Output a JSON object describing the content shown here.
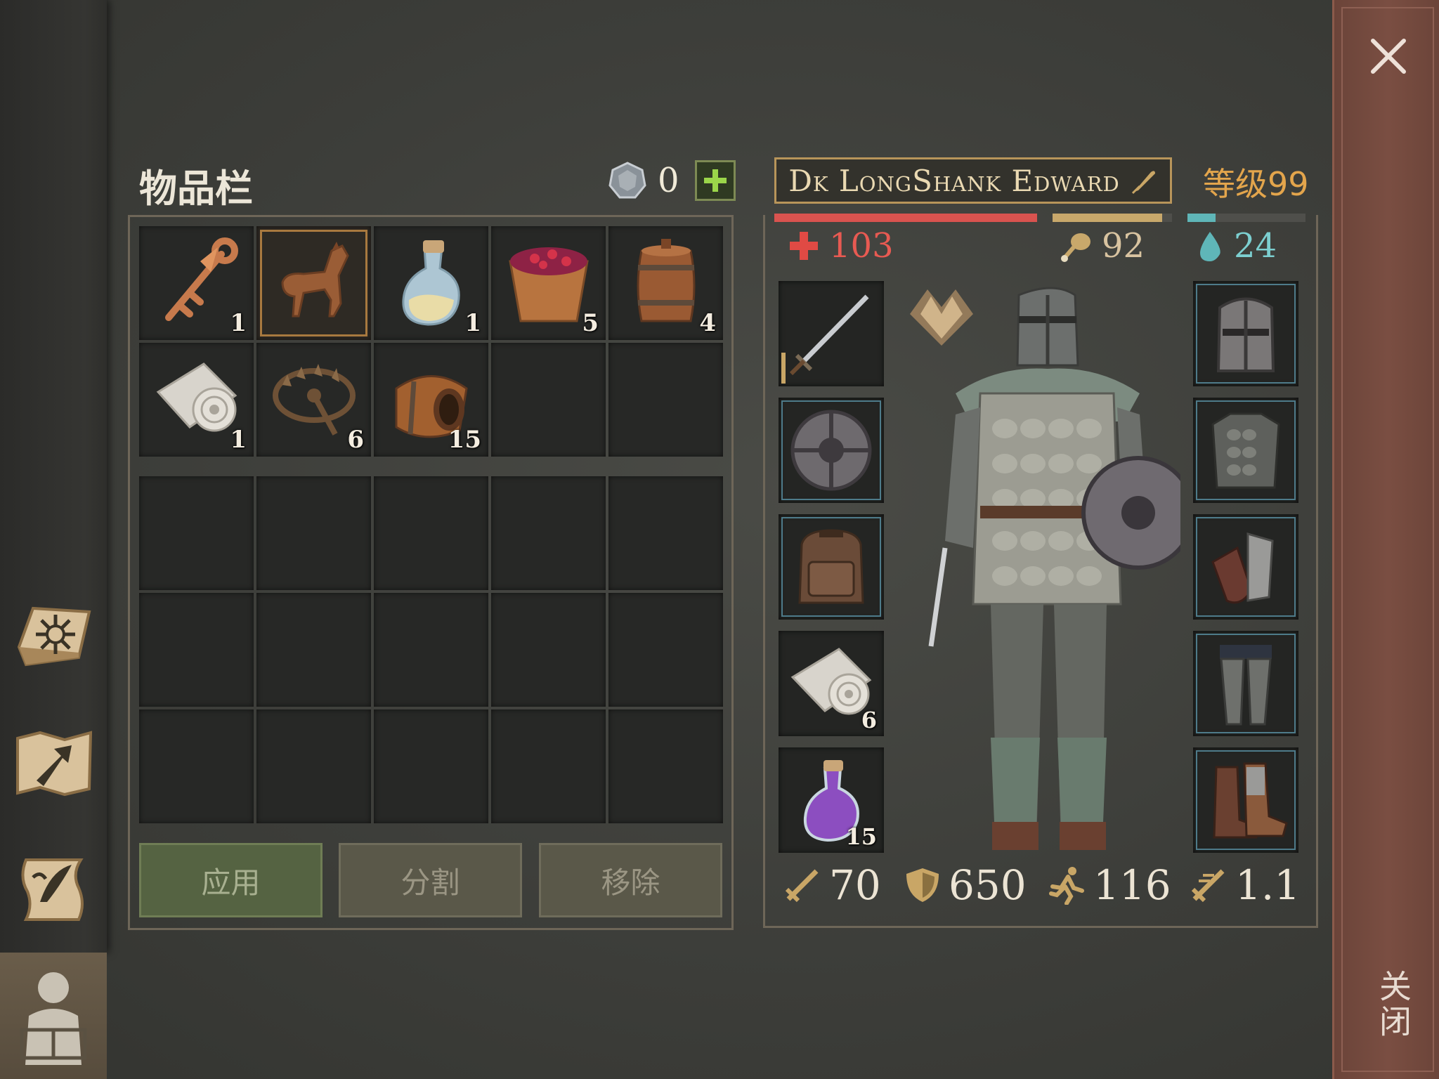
{
  "inventory": {
    "title": "物品栏",
    "currency_value": "0",
    "plus_label": "+",
    "items": [
      {
        "name": "key",
        "qty": "1"
      },
      {
        "name": "wooden-horse",
        "qty": ""
      },
      {
        "name": "potion-bottle",
        "qty": "1"
      },
      {
        "name": "berry-bucket",
        "qty": "5"
      },
      {
        "name": "barrel",
        "qty": "4"
      },
      {
        "name": "cloth-roll",
        "qty": "1"
      },
      {
        "name": "bear-trap",
        "qty": "6"
      },
      {
        "name": "small-barrel",
        "qty": "15"
      }
    ],
    "buttons": {
      "apply": "应用",
      "split": "分割",
      "remove": "移除"
    }
  },
  "character": {
    "name": "Dk LongShank Edward",
    "level": "等级99",
    "health": "103",
    "food": "92",
    "water": "24",
    "bars": {
      "health": 1.0,
      "food": 0.92,
      "water": 0.24
    },
    "slots_left": [
      {
        "name": "sword",
        "qty": ""
      },
      {
        "name": "round-shield",
        "qty": ""
      },
      {
        "name": "backpack",
        "qty": ""
      },
      {
        "name": "cloth-roll",
        "qty": "6"
      },
      {
        "name": "purple-potion",
        "qty": "15"
      }
    ],
    "slots_right": [
      "great-helm",
      "scale-armor",
      "gauntlets",
      "chainmail-leggings",
      "boots"
    ],
    "stats": {
      "attack": "70",
      "defense": "650",
      "speed": "116",
      "attack_speed": "1.1"
    }
  },
  "close_label": "关闭",
  "colors": {
    "health": "#d9534f",
    "food": "#c8a86b",
    "water": "#5fb6b8",
    "level": "#e3a54c",
    "accent": "#b8955a"
  }
}
